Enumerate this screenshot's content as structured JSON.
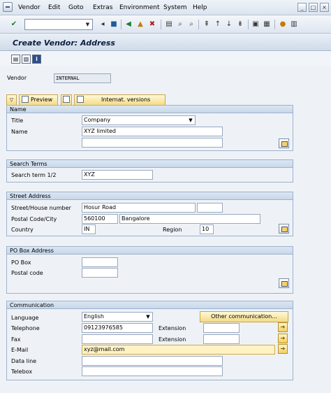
{
  "menubar": {
    "items": [
      {
        "label": "Vendor"
      },
      {
        "label": "Edit"
      },
      {
        "label": "Goto"
      },
      {
        "label": "Extras"
      },
      {
        "label": "Environment"
      },
      {
        "label": "System"
      },
      {
        "label": "Help"
      }
    ]
  },
  "toolbar": {
    "command_value": ""
  },
  "title": "Create Vendor: Address",
  "vendor": {
    "label": "Vendor",
    "value": "INTERNAL"
  },
  "buttons": {
    "preview": "Preview",
    "internat_versions": "Internat. versions"
  },
  "name_group": {
    "header": "Name",
    "title_label": "Title",
    "title_value": "Company",
    "name_label": "Name",
    "name_value": "XYZ limited",
    "name2_value": ""
  },
  "search_group": {
    "header": "Search Terms",
    "term_label": "Search term 1/2",
    "term1_value": "XYZ"
  },
  "street_group": {
    "header": "Street Address",
    "street_label": "Street/House number",
    "street_value": "Hosur Road",
    "house_value": "",
    "postal_label": "Postal Code/City",
    "postal_value": "560100",
    "city_value": "Bangalore",
    "country_label": "Country",
    "country_value": "IN",
    "region_label": "Region",
    "region_value": "10"
  },
  "pobox_group": {
    "header": "PO Box Address",
    "pobox_label": "PO Box",
    "pobox_value": "",
    "postal_label": "Postal code",
    "postal_value": ""
  },
  "comm_group": {
    "header": "Communication",
    "language_label": "Language",
    "language_value": "English",
    "other_comm_label": "Other communication...",
    "telephone_label": "Telephone",
    "telephone_value": "09123976585",
    "extension_label": "Extension",
    "fax_label": "Fax",
    "fax_value": "",
    "fax_extension_label": "Extension",
    "email_label": "E-Mail",
    "email_value": "xyz@mail.com",
    "dataline_label": "Data line",
    "telebox_label": "Telebox"
  },
  "colors": {
    "group_header": "#c8d8ea",
    "button_yellow": "#f5db85",
    "focus_field": "#fff3c4"
  }
}
